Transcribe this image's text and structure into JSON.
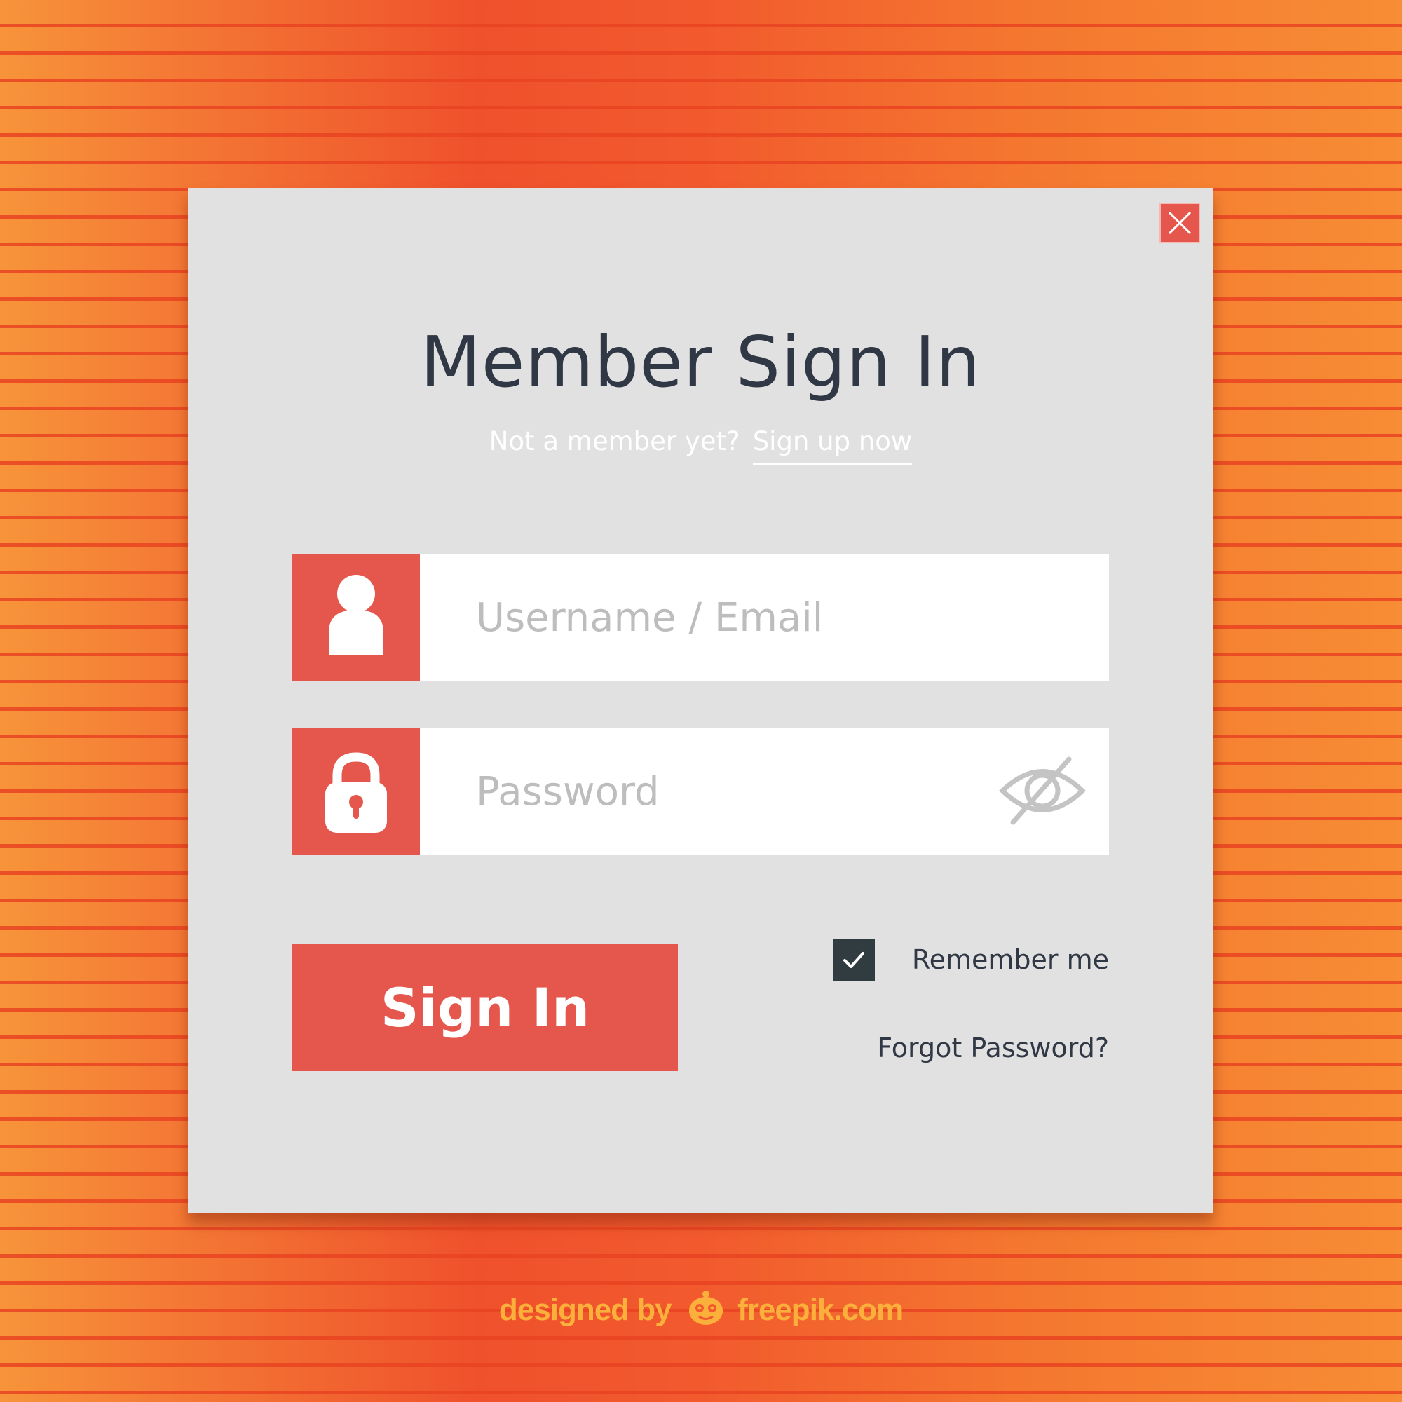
{
  "dialog": {
    "title": "Member Sign In",
    "subtitle_prompt": "Not a member yet?",
    "signup_link": "Sign up now",
    "close_icon": "close-icon"
  },
  "form": {
    "username": {
      "placeholder": "Username / Email",
      "value": "",
      "icon": "user-icon"
    },
    "password": {
      "placeholder": "Password",
      "value": "",
      "icon": "lock-icon",
      "toggle_icon": "eye-slash-icon"
    },
    "signin_label": "Sign In",
    "remember_label": "Remember me",
    "remember_checked": true,
    "forgot_label": "Forgot Password?"
  },
  "footer": {
    "credit_prefix": "designed by",
    "credit_brand": "freepik.com"
  },
  "colors": {
    "accent": "#e5574c",
    "panel": "#e1e1e1",
    "text_dark": "#313845",
    "placeholder": "#bdbdbd",
    "checkbox": "#313c40",
    "background_orange": "#ef512c",
    "credit": "#fbb03b"
  }
}
